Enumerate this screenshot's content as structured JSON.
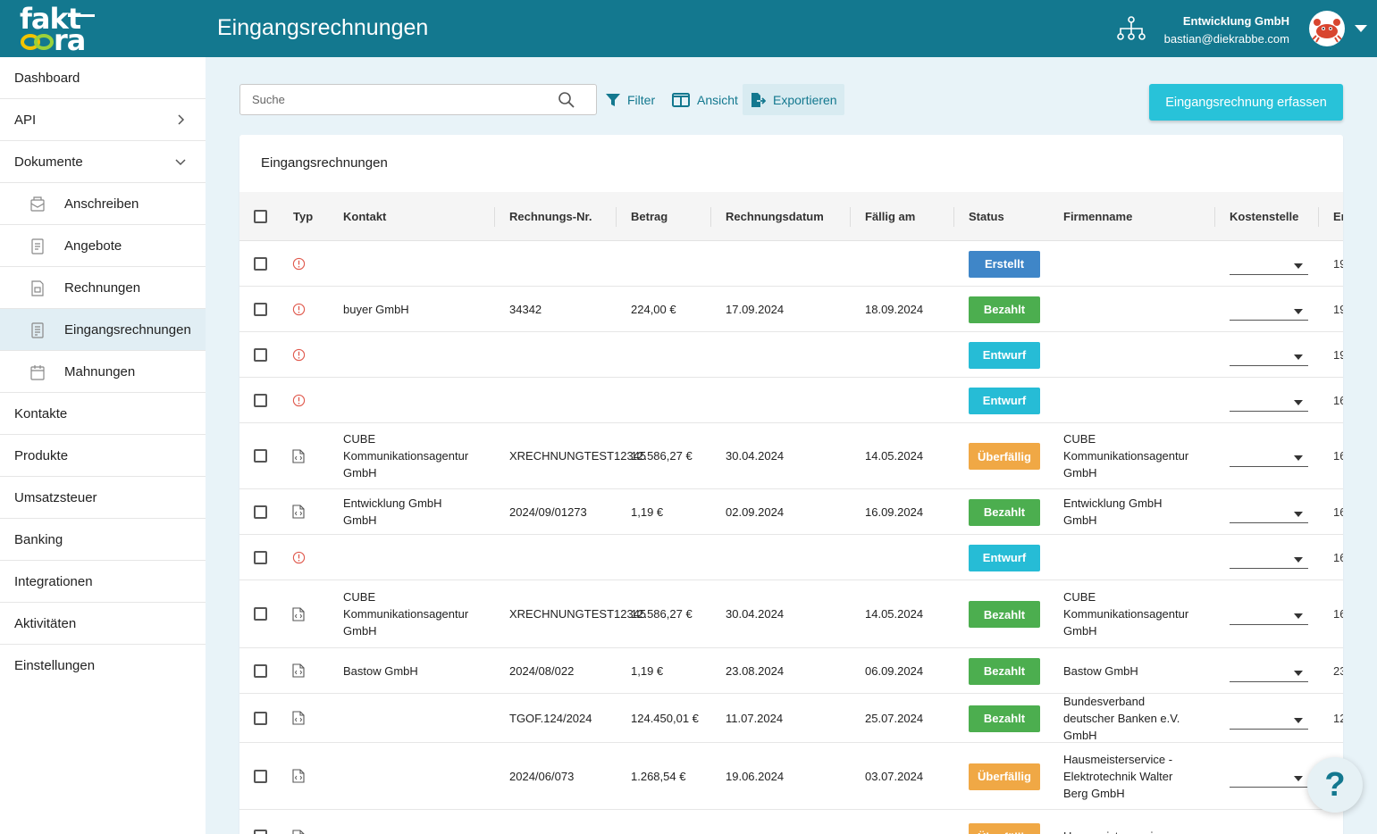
{
  "app": {
    "logo_line1": "fakt",
    "logo_line2": "ra",
    "page_title": "Eingangsrechnungen",
    "account_name": "Entwicklung GmbH",
    "account_email": "bastian@diekrabbe.com"
  },
  "sidebar": {
    "items": [
      {
        "label": "Dashboard",
        "chevron": "none"
      },
      {
        "label": "API",
        "chevron": "right"
      },
      {
        "label": "Dokumente",
        "chevron": "down"
      }
    ],
    "sub_items": [
      {
        "label": "Anschreiben",
        "icon": "letter-icon",
        "active": false
      },
      {
        "label": "Angebote",
        "icon": "offer-icon",
        "active": false
      },
      {
        "label": "Rechnungen",
        "icon": "invoice-icon",
        "active": false
      },
      {
        "label": "Eingangsrechnungen",
        "icon": "incoming-invoice-icon",
        "active": true
      },
      {
        "label": "Mahnungen",
        "icon": "calendar-icon",
        "active": false
      }
    ],
    "bottom_items": [
      "Kontakte",
      "Produkte",
      "Umsatzsteuer",
      "Banking",
      "Integrationen",
      "Aktivitäten",
      "Einstellungen"
    ]
  },
  "toolbar": {
    "search_placeholder": "Suche",
    "filter_label": "Filter",
    "view_label": "Ansicht",
    "export_label": "Exportieren",
    "primary_label": "Eingangsrechnung erfassen"
  },
  "table": {
    "title": "Eingangsrechnungen",
    "columns": [
      "Typ",
      "Kontakt",
      "Rechnungs-Nr.",
      "Betrag",
      "Rechnungsdatum",
      "Fällig am",
      "Status",
      "Firmenname",
      "Kostenstelle",
      "Er"
    ],
    "rows": [
      {
        "typ": "warning",
        "kontakt": "",
        "nr": "",
        "betrag": "",
        "datum": "",
        "faellig": "",
        "status": "Erstellt",
        "firma": "",
        "cut": "19"
      },
      {
        "typ": "warning",
        "kontakt": "buyer GmbH",
        "nr": "34342",
        "betrag": "224,00 €",
        "datum": "17.09.2024",
        "faellig": "18.09.2024",
        "status": "Bezahlt",
        "firma": "",
        "cut": "19"
      },
      {
        "typ": "warning",
        "kontakt": "",
        "nr": "",
        "betrag": "",
        "datum": "",
        "faellig": "",
        "status": "Entwurf",
        "firma": "",
        "cut": "19"
      },
      {
        "typ": "warning",
        "kontakt": "",
        "nr": "",
        "betrag": "",
        "datum": "",
        "faellig": "",
        "status": "Entwurf",
        "firma": "",
        "cut": "16"
      },
      {
        "typ": "document",
        "kontakt": "CUBE Kommunikationsagentur GmbH",
        "nr": "XRECHNUNGTEST12345",
        "betrag": "12.586,27 €",
        "datum": "30.04.2024",
        "faellig": "14.05.2024",
        "status": "Überfällig",
        "firma": "CUBE Kommunikationsagentur GmbH",
        "cut": "16"
      },
      {
        "typ": "document",
        "kontakt": "Entwicklung GmbH GmbH",
        "nr": "2024/09/01273",
        "betrag": "1,19 €",
        "datum": "02.09.2024",
        "faellig": "16.09.2024",
        "status": "Bezahlt",
        "firma": "Entwicklung GmbH GmbH",
        "cut": "16"
      },
      {
        "typ": "warning",
        "kontakt": "",
        "nr": "",
        "betrag": "",
        "datum": "",
        "faellig": "",
        "status": "Entwurf",
        "firma": "",
        "cut": "16"
      },
      {
        "typ": "document",
        "kontakt": "CUBE Kommunikationsagentur GmbH",
        "nr": "XRECHNUNGTEST12345",
        "betrag": "12.586,27 €",
        "datum": "30.04.2024",
        "faellig": "14.05.2024",
        "status": "Bezahlt",
        "firma": "CUBE Kommunikationsagentur GmbH",
        "cut": "16"
      },
      {
        "typ": "document",
        "kontakt": "Bastow GmbH",
        "nr": "2024/08/022",
        "betrag": "1,19 €",
        "datum": "23.08.2024",
        "faellig": "06.09.2024",
        "status": "Bezahlt",
        "firma": "Bastow GmbH",
        "cut": "23"
      },
      {
        "typ": "document",
        "kontakt": "",
        "nr": "TGOF.124/2024",
        "betrag": "124.450,01 €",
        "datum": "11.07.2024",
        "faellig": "25.07.2024",
        "status": "Bezahlt",
        "firma": "Bundesverband deutscher Banken e.V. GmbH",
        "cut": "12"
      },
      {
        "typ": "document",
        "kontakt": "",
        "nr": "2024/06/073",
        "betrag": "1.268,54 €",
        "datum": "19.06.2024",
        "faellig": "03.07.2024",
        "status": "Überfällig",
        "firma": "Hausmeisterservice - Elektrotechnik Walter Berg GmbH",
        "cut": ""
      },
      {
        "typ": "document",
        "kontakt": "",
        "nr": "",
        "betrag": "",
        "datum": "",
        "faellig": "",
        "status": "Überfällig",
        "firma": "Hausmeisterservice -",
        "cut": ""
      }
    ]
  },
  "status_colors": {
    "Erstellt": "#3f86c8",
    "Bezahlt": "#4cae4f",
    "Entwurf": "#26bcd6",
    "Überfällig": "#f0a845"
  },
  "colors": {
    "brand": "#13788f",
    "accent": "#28c2d9",
    "warning": "#e05a4e"
  },
  "help": {
    "label": "?"
  }
}
